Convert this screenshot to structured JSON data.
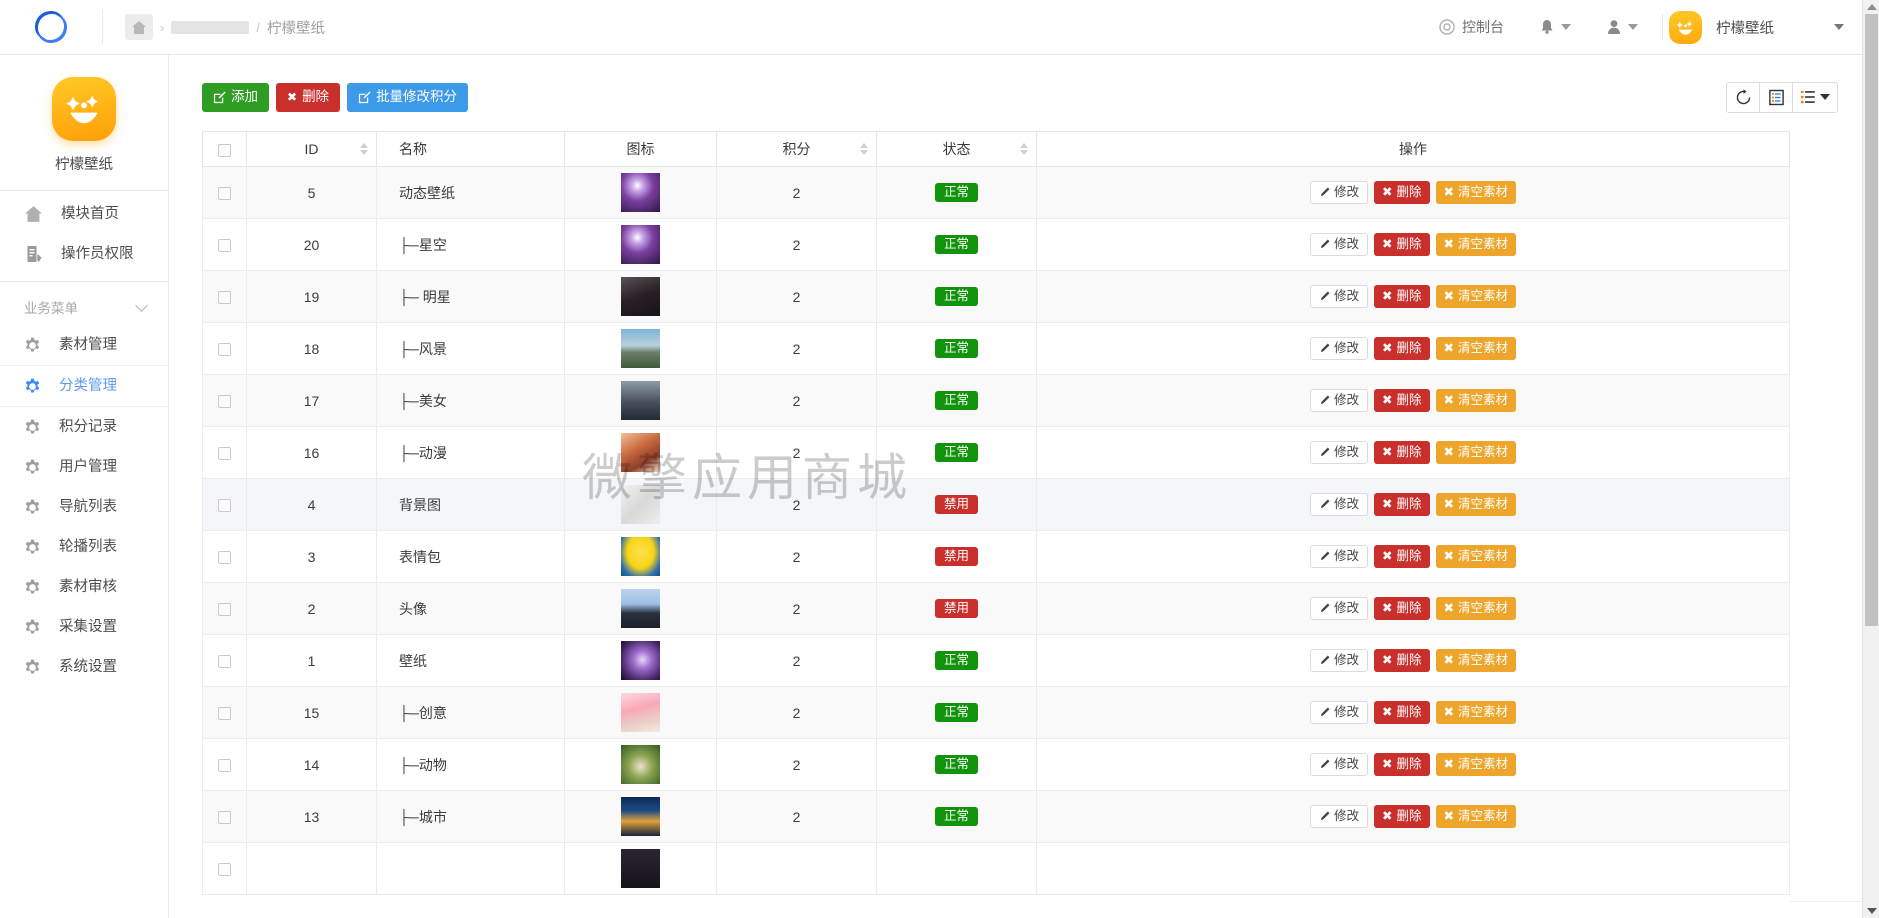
{
  "header": {
    "breadcrumb": {
      "home_icon": "home-icon",
      "hidden_segment": "",
      "separator": "/",
      "current": "柠檬壁纸"
    },
    "console_label": "控制台",
    "console_icon": "target-icon",
    "bell_icon": "bell-icon",
    "user_icon": "user-icon",
    "account_name": "柠檬壁纸",
    "avatar_icon": "smiley-avatar"
  },
  "sidebar": {
    "brand": {
      "name": "柠檬壁纸",
      "logo_icon": "smiley-logo"
    },
    "top_items": [
      {
        "label": "模块首页",
        "icon": "home-icon",
        "active": false
      },
      {
        "label": "操作员权限",
        "icon": "document-pen-icon",
        "active": false
      }
    ],
    "group_label": "业务菜单",
    "group_chevron_icon": "chevron-down-icon",
    "items": [
      {
        "label": "素材管理",
        "icon": "gear-icon",
        "active": false
      },
      {
        "label": "分类管理",
        "icon": "gear-icon",
        "active": true
      },
      {
        "label": "积分记录",
        "icon": "gear-icon",
        "active": false
      },
      {
        "label": "用户管理",
        "icon": "gear-icon",
        "active": false
      },
      {
        "label": "导航列表",
        "icon": "gear-icon",
        "active": false
      },
      {
        "label": "轮播列表",
        "icon": "gear-icon",
        "active": false
      },
      {
        "label": "素材审核",
        "icon": "gear-icon",
        "active": false
      },
      {
        "label": "采集设置",
        "icon": "gear-icon",
        "active": false
      },
      {
        "label": "系统设置",
        "icon": "gear-icon",
        "active": false
      }
    ]
  },
  "toolbar": {
    "add_label": "添加",
    "add_icon": "pencil-square-icon",
    "delete_label": "删除",
    "delete_icon": "x-icon",
    "batch_label": "批量修改积分",
    "batch_icon": "pencil-square-icon",
    "refresh_icon": "refresh-icon",
    "export_icon": "document-list-icon",
    "columns_icon": "list-icon",
    "columns_caret_icon": "caret-down-icon"
  },
  "watermark": "微擎应用商城",
  "table": {
    "columns": [
      {
        "key": "checkbox",
        "label": "",
        "sortable": false
      },
      {
        "key": "id",
        "label": "ID",
        "sortable": true
      },
      {
        "key": "name",
        "label": "名称",
        "sortable": false
      },
      {
        "key": "icon",
        "label": "图标",
        "sortable": false
      },
      {
        "key": "points",
        "label": "积分",
        "sortable": true
      },
      {
        "key": "status",
        "label": "状态",
        "sortable": true
      },
      {
        "key": "ops",
        "label": "操作",
        "sortable": false
      }
    ],
    "row_actions": {
      "edit_label": "修改",
      "edit_icon": "pencil-icon",
      "delete_label": "删除",
      "delete_icon": "x-icon",
      "clear_label": "清空素材",
      "clear_icon": "x-icon"
    },
    "status_labels": {
      "normal": "正常",
      "disabled": "禁用"
    },
    "rows": [
      {
        "id": "5",
        "name": "动态壁纸",
        "points": "2",
        "status": "正常",
        "thumb": "galaxy",
        "selected": false
      },
      {
        "id": "20",
        "name": "├─星空",
        "points": "2",
        "status": "正常",
        "thumb": "galaxy",
        "selected": false
      },
      {
        "id": "19",
        "name": "├─ 明星",
        "points": "2",
        "status": "正常",
        "thumb": "portrait",
        "selected": false
      },
      {
        "id": "18",
        "name": "├─风景",
        "points": "2",
        "status": "正常",
        "thumb": "mountain",
        "selected": false
      },
      {
        "id": "17",
        "name": "├─美女",
        "points": "2",
        "status": "正常",
        "thumb": "girl",
        "selected": false
      },
      {
        "id": "16",
        "name": "├─动漫",
        "points": "2",
        "status": "正常",
        "thumb": "anime",
        "selected": false
      },
      {
        "id": "4",
        "name": "背景图",
        "points": "2",
        "status": "禁用",
        "thumb": "sketch",
        "selected": true
      },
      {
        "id": "3",
        "name": "表情包",
        "points": "2",
        "status": "禁用",
        "thumb": "minion",
        "selected": false
      },
      {
        "id": "2",
        "name": "头像",
        "points": "2",
        "status": "禁用",
        "thumb": "avatar",
        "selected": false
      },
      {
        "id": "1",
        "name": "壁纸",
        "points": "2",
        "status": "正常",
        "thumb": "purple",
        "selected": false
      },
      {
        "id": "15",
        "name": "├─创意",
        "points": "2",
        "status": "正常",
        "thumb": "couple",
        "selected": false
      },
      {
        "id": "14",
        "name": "├─动物",
        "points": "2",
        "status": "正常",
        "thumb": "dog",
        "selected": false
      },
      {
        "id": "13",
        "name": "├─城市",
        "points": "2",
        "status": "正常",
        "thumb": "city",
        "selected": false
      },
      {
        "id": "",
        "name": "",
        "points": "",
        "status": "",
        "thumb": "dark",
        "selected": false
      }
    ]
  },
  "colors": {
    "green": "#2f9c24",
    "red": "#c9302c",
    "blue": "#3c9ae8",
    "orange": "#eda52b",
    "accent": "#5f9bf0",
    "badge_ok": "#12930c"
  }
}
